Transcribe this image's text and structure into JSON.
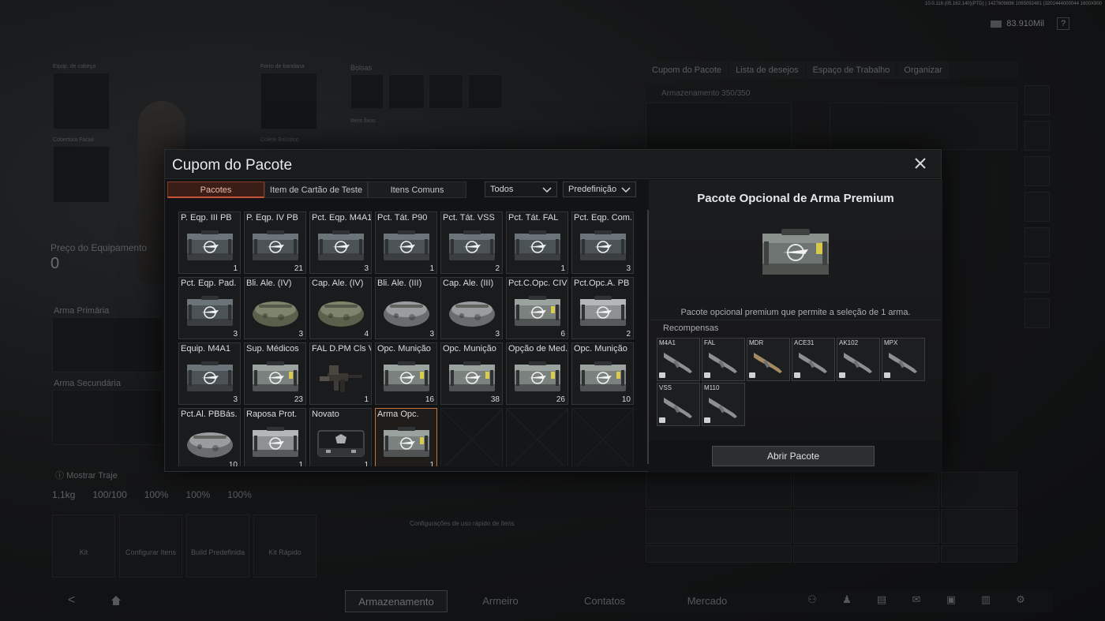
{
  "top": {
    "build_info": "10.0.116 (05.162.140)(PTD) | 1427609896 1065092481 (3202444000044 1600X900",
    "currency": "83.910Mil",
    "help": "?"
  },
  "background": {
    "left_labels": [
      "Equip. de cabeça",
      "Cobertura Facial",
      "Forro de bandana",
      "Colete Balístico",
      "Bolsas",
      "Itens fixos"
    ],
    "equipment_price_label": "Preço do Equipamento",
    "equipment_price_value": "0",
    "primary_weapon": "Arma Primária",
    "secondary_weapon": "Arma Secundária",
    "show_clothing": "Mostrar Traje",
    "stats": [
      "1,1kg",
      "100/100",
      "100%",
      "100%",
      "100%"
    ],
    "kit_buttons": [
      "Kit",
      "Configurar Itens",
      "Build Predefinida",
      "Kit Rápido"
    ],
    "quick_slots_label": "Configurações de uso rápido de itens",
    "right_tabs": [
      "Cupom do Pacote",
      "Lista de desejos",
      "Espaço de Trabalho",
      "Organizar"
    ],
    "storage_label": "Armazenamento 350/350"
  },
  "bottom_nav": {
    "tabs": [
      "Armazenamento",
      "Armeiro",
      "Contatos",
      "Mercado"
    ],
    "active": "Armazenamento"
  },
  "modal": {
    "title": "Cupom do Pacote",
    "tabs": [
      "Pacotes",
      "Item de Cartão de Teste",
      "Itens Comuns"
    ],
    "active_tab": "Pacotes",
    "filter_all": "Todos",
    "filter_preset": "Predefinição",
    "items": [
      {
        "name": "P. Eqp. III PB",
        "count": "1",
        "art": "crate-dark"
      },
      {
        "name": "P. Eqp. IV PB",
        "count": "21",
        "art": "crate-dark"
      },
      {
        "name": "Pct. Eqp. M4A1",
        "count": "3",
        "art": "crate-dark"
      },
      {
        "name": "Pct. Tát. P90",
        "count": "1",
        "art": "crate-dark"
      },
      {
        "name": "Pct. Tát. VSS",
        "count": "2",
        "art": "crate-dark"
      },
      {
        "name": "Pct. Tát. FAL",
        "count": "1",
        "art": "crate-dark"
      },
      {
        "name": "Pct. Eqp. Com.",
        "count": "3",
        "art": "crate-dark"
      },
      {
        "name": "Pct. Eqp. Pad.",
        "count": "3",
        "art": "crate-dark"
      },
      {
        "name": "Bli. Ale. (IV)",
        "count": "3",
        "art": "bag-green"
      },
      {
        "name": "Cap. Ale. (IV)",
        "count": "4",
        "art": "bag-green"
      },
      {
        "name": "Bli. Ale. (III)",
        "count": "3",
        "art": "bag-gray"
      },
      {
        "name": "Cap. Ale. (III)",
        "count": "3",
        "art": "bag-gray"
      },
      {
        "name": "Pct.C.Opc. CIV",
        "count": "6",
        "art": "crate-light"
      },
      {
        "name": "Pct.Opc.A. PB",
        "count": "2",
        "art": "crate-silver"
      },
      {
        "name": "Equip. M4A1",
        "count": "3",
        "art": "crate-dark"
      },
      {
        "name": "Sup. Médicos",
        "count": "23",
        "art": "crate-light"
      },
      {
        "name": "FAL D.PM Cls V",
        "count": "1",
        "art": "gun"
      },
      {
        "name": "Opc. Munição",
        "count": "16",
        "art": "crate-light"
      },
      {
        "name": "Opc. Munição",
        "count": "38",
        "art": "crate-light"
      },
      {
        "name": "Opção de Med.",
        "count": "26",
        "art": "crate-light"
      },
      {
        "name": "Opc. Munição",
        "count": "10",
        "art": "crate-light"
      },
      {
        "name": "Pct.Al. PBBás.",
        "count": "10",
        "art": "bag-gray"
      },
      {
        "name": "Raposa Prot.",
        "count": "1",
        "art": "crate-silver"
      },
      {
        "name": "Novato",
        "count": "1",
        "art": "case-black"
      },
      {
        "name": "Arma Opc.",
        "count": "1",
        "art": "crate-light",
        "selected": true
      }
    ],
    "detail": {
      "title": "Pacote Opcional de Arma Premium",
      "description": "Pacote opcional premium que permite a seleção de 1 arma.",
      "rewards_label": "Recompensas",
      "rewards": [
        "M4A1",
        "FAL",
        "MDR",
        "ACE31",
        "AK102",
        "MPX",
        "VSS",
        "M110"
      ],
      "open_button": "Abrir Pacote"
    }
  }
}
